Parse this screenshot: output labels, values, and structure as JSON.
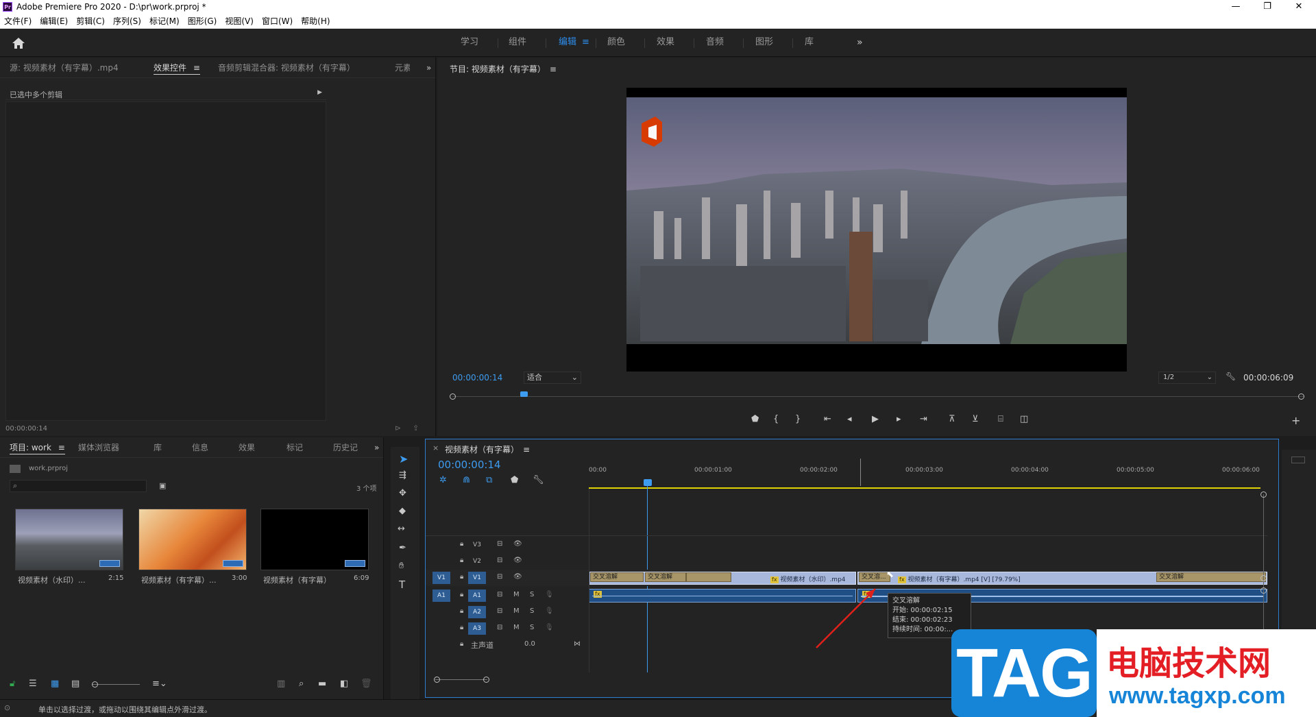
{
  "window": {
    "title": "Adobe Premiere Pro 2020 - D:\\pr\\work.prproj *",
    "app_icon": "Pr"
  },
  "menu": [
    "文件(F)",
    "编辑(E)",
    "剪辑(C)",
    "序列(S)",
    "标记(M)",
    "图形(G)",
    "视图(V)",
    "窗口(W)",
    "帮助(H)"
  ],
  "workspaces": [
    {
      "label": "学习"
    },
    {
      "label": "组件"
    },
    {
      "label": "编辑",
      "active": true
    },
    {
      "label": "颜色"
    },
    {
      "label": "效果"
    },
    {
      "label": "音频"
    },
    {
      "label": "图形"
    },
    {
      "label": "库"
    }
  ],
  "source_panel": {
    "tabs": [
      "源: 视频素材（有字幕）.mp4",
      "效果控件",
      "音频剪辑混合器: 视频素材（有字幕）",
      "元素"
    ],
    "active_tab": "效果控件",
    "selection_text": "已选中多个剪辑",
    "timecode": "00:00:00:14"
  },
  "program_monitor": {
    "title": "节目: 视频素材（有字幕）",
    "timecode": "00:00:00:14",
    "fit": "适合",
    "resolution": "1/2",
    "duration": "00:00:06:09"
  },
  "project_panel": {
    "tabs": [
      "项目: work",
      "媒体浏览器",
      "库",
      "信息",
      "效果",
      "标记",
      "历史记"
    ],
    "active_tab": "项目: work",
    "file": "work.prproj",
    "item_count": "3 个项",
    "items": [
      {
        "name": "视频素材（水印）...",
        "duration": "2:15"
      },
      {
        "name": "视频素材（有字幕）...",
        "duration": "3:00"
      },
      {
        "name": "视频素材（有字幕）",
        "duration": "6:09"
      }
    ]
  },
  "timeline": {
    "title": "视频素材（有字幕）",
    "timecode": "00:00:00:14",
    "ruler": [
      "00:00",
      "00:00:01:00",
      "00:00:02:00",
      "00:00:03:00",
      "00:00:04:00",
      "00:00:05:00",
      "00:00:06:00"
    ],
    "tracks": {
      "v3": "V3",
      "v2": "V2",
      "v1_src": "V1",
      "v1": "V1",
      "a1_src": "A1",
      "a1": "A1",
      "a2": "A2",
      "a3": "A3",
      "master": "主声道",
      "master_value": "0.0",
      "m": "M",
      "s": "S"
    },
    "transition_label": "交叉溶解",
    "transition_short": "交叉溶...",
    "clip1": "视频素材（水印）.mp4",
    "clip2": "视频素材（有字幕）.mp4 [V] [79.79%]",
    "fx": "fx",
    "tooltip": {
      "title": "交叉溶解",
      "start": "开始: 00:00:02:15",
      "end": "结束: 00:00:02:23",
      "duration": "持续时间: 00:00:..."
    }
  },
  "status_bar": "单击以选择过渡，或拖动以围绕其编辑点外滑过渡。",
  "watermark": {
    "tag": "TAG",
    "title": "电脑技术网",
    "url": "www.tagxp.com"
  },
  "colors": {
    "accent": "#2d8ceb",
    "playhead": "#3d9cf0",
    "clip_video": "#a7b8dc",
    "clip_audio": "#1f4f85",
    "transition": "#a89669"
  }
}
